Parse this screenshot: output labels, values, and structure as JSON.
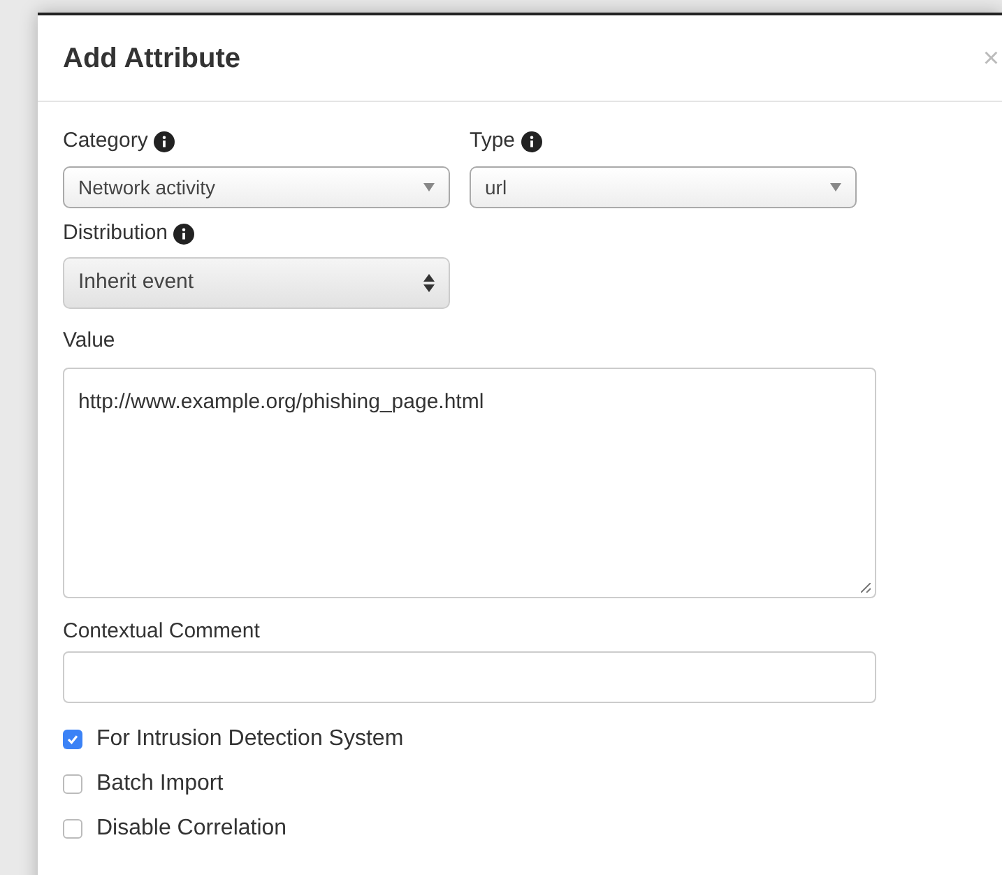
{
  "dialog": {
    "title": "Add Attribute",
    "close": "×"
  },
  "fields": [
    {
      "kind": "select",
      "label": "Category",
      "info": true,
      "value": "Network activity"
    },
    {
      "kind": "select",
      "label": "Type",
      "info": true,
      "value": "url"
    },
    {
      "kind": "native-select",
      "label": "Distribution",
      "info": true,
      "value": "Inherit event"
    },
    {
      "kind": "textarea",
      "label": "Value",
      "info": false,
      "value": "http://www.example.org/phishing_page.html"
    },
    {
      "kind": "input",
      "label": "Contextual Comment",
      "info": false
    }
  ],
  "checkboxes": [
    {
      "label": "For Intrusion Detection System",
      "checked": true
    },
    {
      "label": "Batch Import",
      "checked": false
    },
    {
      "label": "Disable Correlation",
      "checked": false
    }
  ]
}
